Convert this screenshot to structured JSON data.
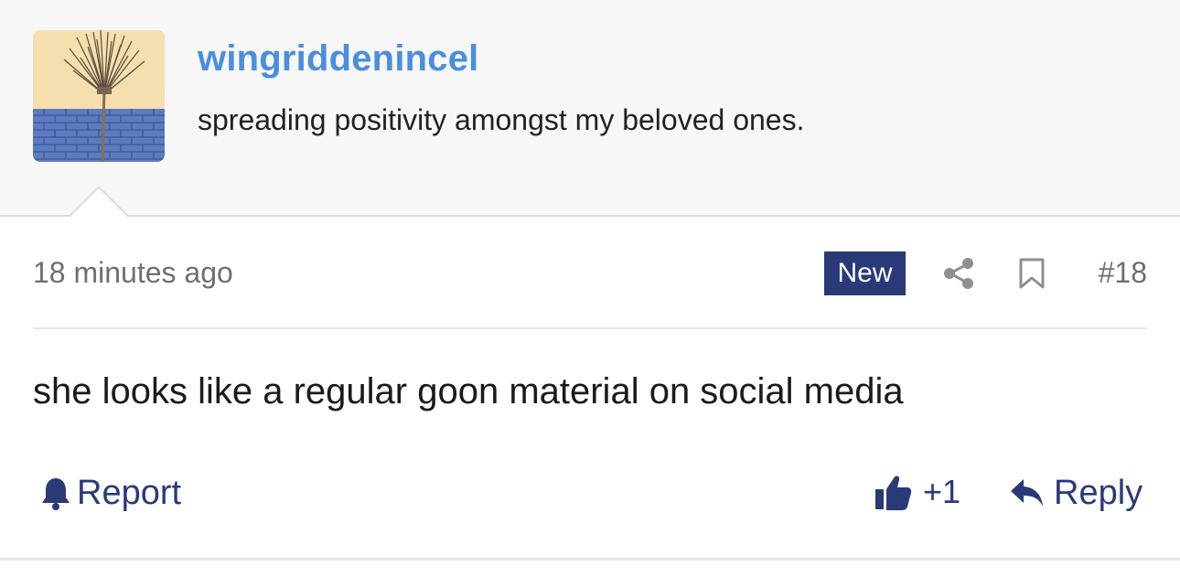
{
  "user": {
    "username": "wingriddenincel",
    "title": "spreading positivity amongst my beloved ones.",
    "avatar_icon": "broom-against-blue-brick-wall-avatar"
  },
  "meta": {
    "time": "18 minutes ago",
    "badge": "New",
    "share_icon": "share-icon",
    "bookmark_icon": "bookmark-icon",
    "post_number": "#18"
  },
  "body": {
    "text": "she looks like a regular goon material on social media"
  },
  "actions": {
    "report_label": "Report",
    "report_icon": "bell-icon",
    "like_label": "+1",
    "like_icon": "thumbs-up-icon",
    "reply_label": "Reply",
    "reply_icon": "reply-arrow-icon"
  },
  "colors": {
    "accent": "#4a8fdd",
    "action": "#2a3a78",
    "badge_bg": "#2a3a78",
    "muted_text": "#6e6e73"
  }
}
